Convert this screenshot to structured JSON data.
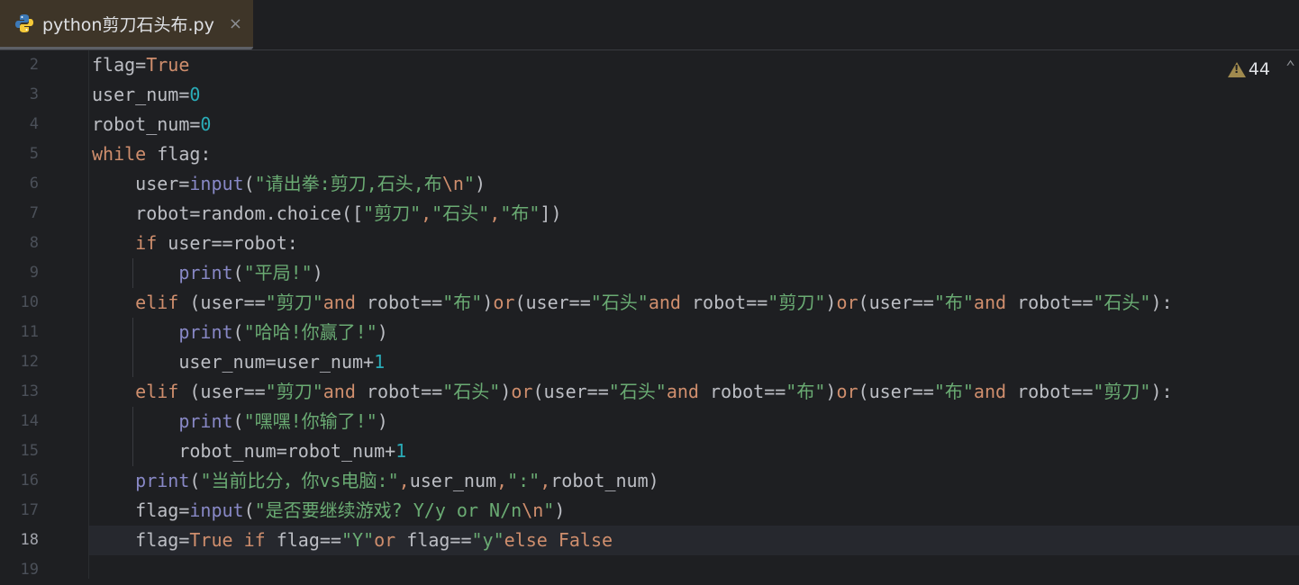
{
  "tab": {
    "filename": "python剪刀石头布.py",
    "close": "×",
    "icon": "python-icon"
  },
  "inspections": {
    "warning_count": "44",
    "icon": "warning-icon"
  },
  "current_line": 18,
  "lines": [
    {
      "n": "2",
      "tokens": [
        [
          "t",
          "flag="
        ],
        [
          "kw",
          "True"
        ]
      ]
    },
    {
      "n": "3",
      "tokens": [
        [
          "t",
          "user_num="
        ],
        [
          "num",
          "0"
        ]
      ]
    },
    {
      "n": "4",
      "tokens": [
        [
          "t",
          "robot_num="
        ],
        [
          "num",
          "0"
        ]
      ]
    },
    {
      "n": "5",
      "tokens": [
        [
          "kw",
          "while"
        ],
        [
          "t",
          " flag:"
        ]
      ]
    },
    {
      "n": "6",
      "tokens": [
        [
          "t",
          "    user="
        ],
        [
          "bi",
          "input"
        ],
        [
          "t",
          "("
        ],
        [
          "str",
          "\"请出拳:剪刀,石头,布"
        ],
        [
          "esc",
          "\\n"
        ],
        [
          "str",
          "\""
        ],
        [
          "t",
          ")"
        ]
      ]
    },
    {
      "n": "7",
      "tokens": [
        [
          "t",
          "    robot=random.choice(["
        ],
        [
          "str",
          "\"剪刀\""
        ],
        [
          "kw",
          ","
        ],
        [
          "str",
          "\"石头\""
        ],
        [
          "kw",
          ","
        ],
        [
          "str",
          "\"布\""
        ],
        [
          "t",
          "])"
        ]
      ]
    },
    {
      "n": "8",
      "tokens": [
        [
          "t",
          "    "
        ],
        [
          "kw",
          "if"
        ],
        [
          "t",
          " user==robot:"
        ]
      ]
    },
    {
      "n": "9",
      "tokens": [
        [
          "t",
          "        "
        ],
        [
          "bi",
          "print"
        ],
        [
          "t",
          "("
        ],
        [
          "str",
          "\"平局!\""
        ],
        [
          "t",
          ")"
        ]
      ]
    },
    {
      "n": "10",
      "tokens": [
        [
          "t",
          "    "
        ],
        [
          "kw",
          "elif"
        ],
        [
          "t",
          " (user=="
        ],
        [
          "str",
          "\"剪刀\""
        ],
        [
          "kw",
          "and"
        ],
        [
          "t",
          " robot=="
        ],
        [
          "str",
          "\"布\""
        ],
        [
          "t",
          ")"
        ],
        [
          "kw",
          "or"
        ],
        [
          "t",
          "(user=="
        ],
        [
          "str",
          "\"石头\""
        ],
        [
          "kw",
          "and"
        ],
        [
          "t",
          " robot=="
        ],
        [
          "str",
          "\"剪刀\""
        ],
        [
          "t",
          ")"
        ],
        [
          "kw",
          "or"
        ],
        [
          "t",
          "(user=="
        ],
        [
          "str",
          "\"布\""
        ],
        [
          "kw",
          "and"
        ],
        [
          "t",
          " robot=="
        ],
        [
          "str",
          "\"石头\""
        ],
        [
          "t",
          "):"
        ]
      ]
    },
    {
      "n": "11",
      "tokens": [
        [
          "t",
          "        "
        ],
        [
          "bi",
          "print"
        ],
        [
          "t",
          "("
        ],
        [
          "str",
          "\"哈哈!你赢了!\""
        ],
        [
          "t",
          ")"
        ]
      ]
    },
    {
      "n": "12",
      "tokens": [
        [
          "t",
          "        user_num=user_num+"
        ],
        [
          "num",
          "1"
        ]
      ]
    },
    {
      "n": "13",
      "tokens": [
        [
          "t",
          "    "
        ],
        [
          "kw",
          "elif"
        ],
        [
          "t",
          " (user=="
        ],
        [
          "str",
          "\"剪刀\""
        ],
        [
          "kw",
          "and"
        ],
        [
          "t",
          " robot=="
        ],
        [
          "str",
          "\"石头\""
        ],
        [
          "t",
          ")"
        ],
        [
          "kw",
          "or"
        ],
        [
          "t",
          "(user=="
        ],
        [
          "str",
          "\"石头\""
        ],
        [
          "kw",
          "and"
        ],
        [
          "t",
          " robot=="
        ],
        [
          "str",
          "\"布\""
        ],
        [
          "t",
          ")"
        ],
        [
          "kw",
          "or"
        ],
        [
          "t",
          "(user=="
        ],
        [
          "str",
          "\"布\""
        ],
        [
          "kw",
          "and"
        ],
        [
          "t",
          " robot=="
        ],
        [
          "str",
          "\"剪刀\""
        ],
        [
          "t",
          "):"
        ]
      ]
    },
    {
      "n": "14",
      "tokens": [
        [
          "t",
          "        "
        ],
        [
          "bi",
          "print"
        ],
        [
          "t",
          "("
        ],
        [
          "str",
          "\"嘿嘿!你输了!\""
        ],
        [
          "t",
          ")"
        ]
      ]
    },
    {
      "n": "15",
      "tokens": [
        [
          "t",
          "        robot_num=robot_num+"
        ],
        [
          "num",
          "1"
        ]
      ]
    },
    {
      "n": "16",
      "tokens": [
        [
          "t",
          "    "
        ],
        [
          "bi",
          "print"
        ],
        [
          "t",
          "("
        ],
        [
          "str",
          "\"当前比分，你vs电脑:\""
        ],
        [
          "kw",
          ","
        ],
        [
          "t",
          "user_num"
        ],
        [
          "kw",
          ","
        ],
        [
          "str",
          "\":\""
        ],
        [
          "kw",
          ","
        ],
        [
          "t",
          "robot_num)"
        ]
      ]
    },
    {
      "n": "17",
      "tokens": [
        [
          "t",
          "    flag="
        ],
        [
          "bi",
          "input"
        ],
        [
          "t",
          "("
        ],
        [
          "str",
          "\"是否要继续游戏? Y/y or N/n"
        ],
        [
          "esc",
          "\\n"
        ],
        [
          "str",
          "\""
        ],
        [
          "t",
          ")"
        ]
      ]
    },
    {
      "n": "18",
      "tokens": [
        [
          "t",
          "    flag="
        ],
        [
          "kw",
          "True"
        ],
        [
          "t",
          " "
        ],
        [
          "kw",
          "if"
        ],
        [
          "t",
          " flag=="
        ],
        [
          "str",
          "\"Y\""
        ],
        [
          "kw",
          "or"
        ],
        [
          "t",
          " flag=="
        ],
        [
          "str",
          "\"y\""
        ],
        [
          "kw",
          "else"
        ],
        [
          "t",
          " "
        ],
        [
          "kw",
          "False"
        ]
      ]
    },
    {
      "n": "19",
      "tokens": []
    }
  ]
}
